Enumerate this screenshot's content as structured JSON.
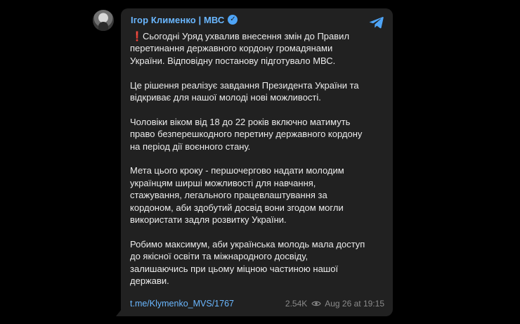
{
  "post": {
    "channel_name": "Ігор Клименко | МВС",
    "paragraphs": [
      {
        "lines": [
          "Сьогодні Уряд ухвалив внесення змін до Правил",
          "перетинання державного кордону громадянами",
          "України. Відповідну постанову підготувало МВС."
        ]
      },
      {
        "lines": [
          "Це рішення реалізує завдання Президента України та",
          "відкриває для нашої молоді нові можливості."
        ]
      },
      {
        "lines": [
          "Чоловіки віком від 18 до 22 років включно матимуть",
          "право безперешкодного перетину державного кордону",
          "на період дії воєнного стану."
        ]
      },
      {
        "lines": [
          "Мета цього кроку - першочергово надати молодим",
          "українцям ширші можливості для навчання,",
          "стажування, легального працевлаштування за",
          "кордоном, аби здобутий досвід вони згодом могли",
          "використати задля розвитку України."
        ]
      },
      {
        "lines": [
          "Робимо максимум, аби українська молодь мала доступ",
          "до якісної освіти та міжнародного досвіду,",
          "залишаючись при цьому міцною частиною нашої",
          "держави."
        ]
      }
    ],
    "link": "t.me/Klymenko_MVS/1767",
    "views": "2.54K",
    "date": "Aug 26 at 19:15"
  },
  "icons": {
    "alert": "red-exclamation-icon",
    "verified": "verified-badge-icon",
    "share": "telegram-icon",
    "views": "eye-icon"
  },
  "colors": {
    "background": "#000000",
    "bubble": "#212121",
    "accent": "#6ab7ff",
    "text": "#ececec",
    "meta": "#8a8a8a",
    "alert": "#e53935"
  }
}
